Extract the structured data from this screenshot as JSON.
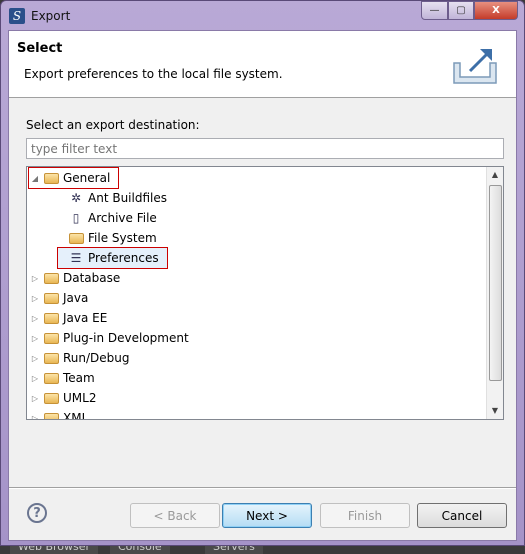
{
  "window": {
    "title": "Export",
    "minimize": "—",
    "maximize": "▢",
    "close": "X"
  },
  "header": {
    "title": "Select",
    "description": "Export preferences to the local file system."
  },
  "destination_label": "Select an export destination:",
  "filter": {
    "value": "",
    "placeholder": "type filter text"
  },
  "tree": [
    {
      "label": "General",
      "level": 0,
      "expanded": true,
      "icon": "folder-open-icon",
      "highlighted": true
    },
    {
      "label": "Ant Buildfiles",
      "level": 1,
      "icon": "ant-icon"
    },
    {
      "label": "Archive File",
      "level": 1,
      "icon": "archive-icon"
    },
    {
      "label": "File System",
      "level": 1,
      "icon": "folder-icon"
    },
    {
      "label": "Preferences",
      "level": 1,
      "icon": "preferences-icon",
      "selected": true,
      "highlighted": true
    },
    {
      "label": "Database",
      "level": 0,
      "expanded": false,
      "icon": "folder-icon"
    },
    {
      "label": "Java",
      "level": 0,
      "expanded": false,
      "icon": "folder-icon"
    },
    {
      "label": "Java EE",
      "level": 0,
      "expanded": false,
      "icon": "folder-icon"
    },
    {
      "label": "Plug-in Development",
      "level": 0,
      "expanded": false,
      "icon": "folder-icon"
    },
    {
      "label": "Run/Debug",
      "level": 0,
      "expanded": false,
      "icon": "folder-icon"
    },
    {
      "label": "Team",
      "level": 0,
      "expanded": false,
      "icon": "folder-icon"
    },
    {
      "label": "UML2",
      "level": 0,
      "expanded": false,
      "icon": "folder-icon"
    },
    {
      "label": "XML",
      "level": 0,
      "expanded": false,
      "icon": "folder-icon"
    }
  ],
  "buttons": {
    "help": "?",
    "back": "< Back",
    "next": "Next >",
    "finish": "Finish",
    "cancel": "Cancel"
  },
  "background_tabs": [
    "Web Browser",
    "Console",
    "Servers"
  ],
  "colors": {
    "highlight_box": "#cc0000",
    "selection": "#e5f0fb",
    "default_button": "#b5dcf4"
  }
}
